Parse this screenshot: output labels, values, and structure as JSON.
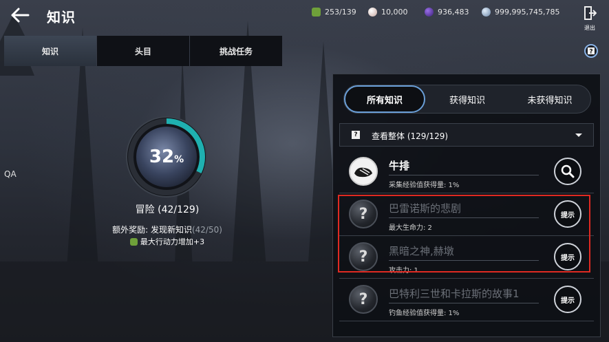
{
  "header": {
    "title": "知识",
    "exit_label": "退出"
  },
  "currencies": [
    {
      "icon": "action-point-icon",
      "value": "253/139",
      "color": "#6fa03a"
    },
    {
      "icon": "pearl-icon",
      "value": "10,000",
      "color": "#e8d8d0"
    },
    {
      "icon": "gem-icon",
      "value": "936,483",
      "color": "#6a3fb8"
    },
    {
      "icon": "silver-coin-icon",
      "value": "999,995,745,785",
      "color": "#aac0d8"
    }
  ],
  "tabs": [
    {
      "label": "知识",
      "active": true
    },
    {
      "label": "头目",
      "active": false
    },
    {
      "label": "挑战任务",
      "active": false
    }
  ],
  "side_label": "QA",
  "progress": {
    "percent": 32,
    "percent_sign": "%",
    "category": "冒险 (42/129)",
    "bonus_prefix": "额外奖励: 发现新知识",
    "bonus_count": "(42/50)",
    "bonus_effect": "最大行动力增加+3",
    "accent": "#1fb0b0"
  },
  "filter": {
    "options": [
      "所有知识",
      "获得知识",
      "未获得知识"
    ],
    "selected": 0,
    "accent": "#6a9fd8"
  },
  "dropdown": {
    "label": "查看整体 (129/129)"
  },
  "knowledge": [
    {
      "name": "牛排",
      "desc": "采集经验值获得量: 1%",
      "known": true,
      "button": "search-icon"
    },
    {
      "name": "巴雷诺斯的悲剧",
      "desc": "最大生命力: 2",
      "known": false,
      "button": "提示"
    },
    {
      "name": "黑暗之神,赫墩",
      "desc": "攻击力: 1",
      "known": false,
      "button": "提示"
    },
    {
      "name": "巴特利三世和卡拉斯的故事1",
      "desc": "钓鱼经验值获得量: 1%",
      "known": false,
      "button": "提示"
    }
  ],
  "highlight_color": "#e02a22"
}
